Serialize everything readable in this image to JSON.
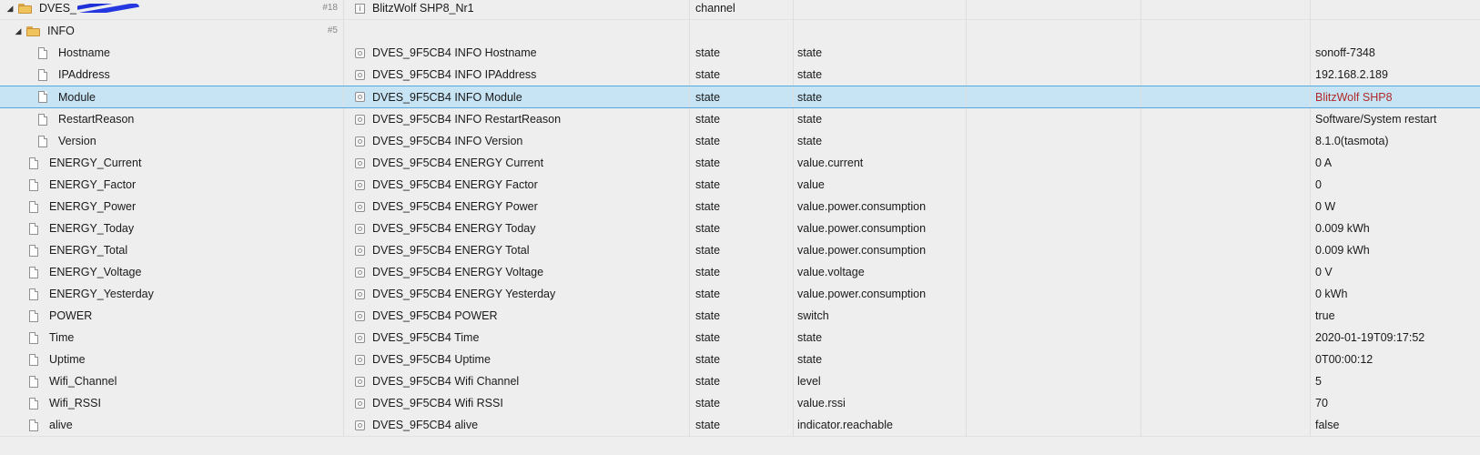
{
  "tree": {
    "root": {
      "name": "DVES_",
      "count": "#18",
      "object_name": "BlitzWolf SHP8_Nr1",
      "type": "channel"
    },
    "info": {
      "name": "INFO",
      "count": "#5"
    },
    "info_rows": [
      {
        "name": "Hostname",
        "object_name": "DVES_9F5CB4 INFO Hostname",
        "type": "state",
        "role": "state",
        "value": "sonoff-7348"
      },
      {
        "name": "IPAddress",
        "object_name": "DVES_9F5CB4 INFO IPAddress",
        "type": "state",
        "role": "state",
        "value": "192.168.2.189"
      },
      {
        "name": "Module",
        "object_name": "DVES_9F5CB4 INFO Module",
        "type": "state",
        "role": "state",
        "value": "BlitzWolf SHP8"
      },
      {
        "name": "RestartReason",
        "object_name": "DVES_9F5CB4 INFO RestartReason",
        "type": "state",
        "role": "state",
        "value": "Software/System restart"
      },
      {
        "name": "Version",
        "object_name": "DVES_9F5CB4 INFO Version",
        "type": "state",
        "role": "state",
        "value": "8.1.0(tasmota)"
      }
    ],
    "rows": [
      {
        "name": "ENERGY_Current",
        "object_name": "DVES_9F5CB4 ENERGY Current",
        "type": "state",
        "role": "value.current",
        "value": "0 A"
      },
      {
        "name": "ENERGY_Factor",
        "object_name": "DVES_9F5CB4 ENERGY Factor",
        "type": "state",
        "role": "value",
        "value": "0"
      },
      {
        "name": "ENERGY_Power",
        "object_name": "DVES_9F5CB4 ENERGY Power",
        "type": "state",
        "role": "value.power.consumption",
        "value": "0 W"
      },
      {
        "name": "ENERGY_Today",
        "object_name": "DVES_9F5CB4 ENERGY Today",
        "type": "state",
        "role": "value.power.consumption",
        "value": "0.009 kWh"
      },
      {
        "name": "ENERGY_Total",
        "object_name": "DVES_9F5CB4 ENERGY Total",
        "type": "state",
        "role": "value.power.consumption",
        "value": "0.009 kWh"
      },
      {
        "name": "ENERGY_Voltage",
        "object_name": "DVES_9F5CB4 ENERGY Voltage",
        "type": "state",
        "role": "value.voltage",
        "value": "0 V"
      },
      {
        "name": "ENERGY_Yesterday",
        "object_name": "DVES_9F5CB4 ENERGY Yesterday",
        "type": "state",
        "role": "value.power.consumption",
        "value": "0 kWh"
      },
      {
        "name": "POWER",
        "object_name": "DVES_9F5CB4 POWER",
        "type": "state",
        "role": "switch",
        "value": "true"
      },
      {
        "name": "Time",
        "object_name": "DVES_9F5CB4 Time",
        "type": "state",
        "role": "state",
        "value": "2020-01-19T09:17:52"
      },
      {
        "name": "Uptime",
        "object_name": "DVES_9F5CB4 Uptime",
        "type": "state",
        "role": "state",
        "value": "0T00:00:12"
      },
      {
        "name": "Wifi_Channel",
        "object_name": "DVES_9F5CB4 Wifi Channel",
        "type": "state",
        "role": "level",
        "value": "5"
      },
      {
        "name": "Wifi_RSSI",
        "object_name": "DVES_9F5CB4 Wifi RSSI",
        "type": "state",
        "role": "value.rssi",
        "value": "70"
      },
      {
        "name": "alive",
        "object_name": "DVES_9F5CB4 alive",
        "type": "state",
        "role": "indicator.reachable",
        "value": "false"
      }
    ]
  },
  "colors": {
    "selected_bg": "#c7e4f5",
    "selected_border": "#55a8dc",
    "highlight_value": "#b02a2a",
    "folder": "#f1c35c"
  }
}
